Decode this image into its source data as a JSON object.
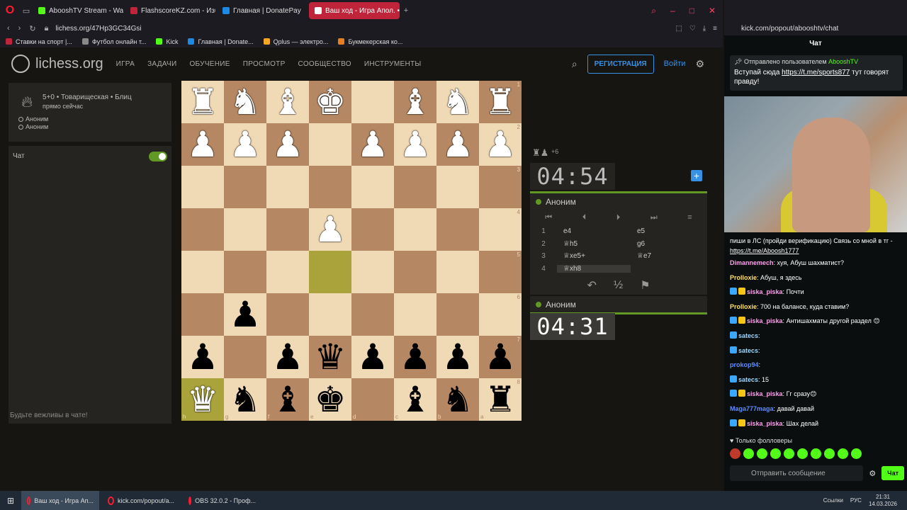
{
  "browser": {
    "tabs": [
      {
        "label": "AbooshTV Stream - Watch",
        "color": "#53fc18"
      },
      {
        "label": "FlashscoreKZ.com - Изб",
        "color": "#c0243a"
      },
      {
        "label": "Главная | DonatePay",
        "color": "#1e88e5"
      },
      {
        "label": "Ваш ход - Игра Апол. • li",
        "color": "#fff",
        "active": true
      }
    ],
    "url": "lichess.org/47Hp3GC34Gsi",
    "bookmarks": [
      {
        "label": "Ставки на спорт |...",
        "color": "#c0243a"
      },
      {
        "label": "Футбол онлайн т...",
        "color": "#888"
      },
      {
        "label": "Kick",
        "color": "#53fc18"
      },
      {
        "label": "Главная | Donate...",
        "color": "#1e88e5"
      },
      {
        "label": "Qplus — электро...",
        "color": "#f5a623"
      },
      {
        "label": "Букмекерская ко...",
        "color": "#e67e22"
      }
    ]
  },
  "lichess": {
    "site_name": "lichess.org",
    "menu": [
      "Игра",
      "Задачи",
      "Обучение",
      "Просмотр",
      "Сообщество",
      "Инструменты"
    ],
    "register_label": "Регистрация",
    "login_label": "Войти",
    "game_info": {
      "mode": "5+0 • Товарищеская • Блиц",
      "status": "прямо сейчас",
      "player1": "Аноним",
      "player2": "Аноним"
    },
    "chat": {
      "title": "Чат",
      "polite": "Будьте вежливы в чате!"
    },
    "material": {
      "pieces": "♜♟",
      "diff": "+6"
    },
    "top_clock": "04:54",
    "bottom_clock": "04:31",
    "top_player": "Аноним",
    "bottom_player": "Аноним",
    "moves": [
      {
        "n": "1",
        "w": "e4",
        "b": "e5"
      },
      {
        "n": "2",
        "w": "♕h5",
        "b": "g6"
      },
      {
        "n": "3",
        "w": "♕xe5+",
        "b": "♕e7"
      },
      {
        "n": "4",
        "w": "♕xh8",
        "b": ""
      }
    ],
    "board": [
      [
        "wr",
        "wn",
        "wb",
        "wk",
        "",
        "wb",
        "wn",
        "wr"
      ],
      [
        "wp",
        "wp",
        "wp",
        "",
        "wp",
        "wp",
        "wp",
        "wp"
      ],
      [
        "",
        "",
        "",
        "",
        "",
        "",
        "",
        ""
      ],
      [
        "",
        "",
        "",
        "wp",
        "",
        "",
        "",
        ""
      ],
      [
        "",
        "",
        "",
        "",
        "",
        "",
        "",
        ""
      ],
      [
        "",
        "bp",
        "",
        "",
        "",
        "",
        "",
        ""
      ],
      [
        "bp",
        "",
        "bp",
        "bq",
        "bp",
        "bp",
        "bp",
        "bp"
      ],
      [
        "wq",
        "bn",
        "bb",
        "bk",
        "",
        "bb",
        "bn",
        "br"
      ]
    ],
    "ranks": [
      "1",
      "2",
      "3",
      "4",
      "5",
      "6",
      "7",
      "8"
    ],
    "files": [
      "h",
      "g",
      "f",
      "e",
      "d",
      "c",
      "b",
      "a"
    ]
  },
  "kick": {
    "url": "kick.com/popout/abooshtv/chat",
    "chat_title": "Чат",
    "pinned_by": "Отправлено пользователем",
    "pinned_user": "AbooshTV",
    "pinned_text": "Вступай сюда",
    "pinned_link": "https://t.me/sports877",
    "pinned_tail": "тут говорят правду!",
    "top_text": "пиши в ЛС (пройди верификацию) Связь со мной в тг -",
    "top_link": "https://t.me/Aboosh1777",
    "messages": [
      {
        "nick": "Dimannemech",
        "color": "#ff9eee",
        "text": "хуя, Абуш шахматист?",
        "badges": 0
      },
      {
        "nick": "Prolloxie",
        "color": "#ffe066",
        "text": "Абуш, я здесь",
        "badges": 0
      },
      {
        "nick": "siska_piska",
        "color": "#ff9eee",
        "text": "Почти",
        "badges": 2
      },
      {
        "nick": "Prolloxie",
        "color": "#ffe066",
        "text": "700 на балансе, куда ставим?",
        "badges": 0
      },
      {
        "nick": "siska_piska",
        "color": "#ff9eee",
        "text": "Антишахматы другой раздел 😊",
        "badges": 2
      },
      {
        "nick": "satecs",
        "color": "#9ad7ff",
        "text": "",
        "badges": 1
      },
      {
        "nick": "satecs",
        "color": "#9ad7ff",
        "text": "",
        "badges": 1
      },
      {
        "nick": "prokop94",
        "color": "#5b8cff",
        "text": "",
        "badges": 0
      },
      {
        "nick": "satecs",
        "color": "#9ad7ff",
        "text": "15",
        "badges": 1
      },
      {
        "nick": "siska_piska",
        "color": "#ff9eee",
        "text": "Гг сразу😊",
        "badges": 2
      },
      {
        "nick": "Maga777maga",
        "color": "#5b8cff",
        "text": "давай давай",
        "badges": 0
      },
      {
        "nick": "siska_piska",
        "color": "#ff9eee",
        "text": "Шах делай",
        "badges": 2
      }
    ],
    "followers_only": "Только фолловеры",
    "input_placeholder": "Отправить сообщение",
    "send_label": "Чат"
  },
  "taskbar": {
    "items": [
      "Ваш ход - Игра Ап...",
      "kick.com/popout/a...",
      "OBS 32.0.2 - Проф..."
    ],
    "tray_label": "Ссылки",
    "lang": "РУС",
    "time": "21:31",
    "date": "14.03.2026"
  }
}
